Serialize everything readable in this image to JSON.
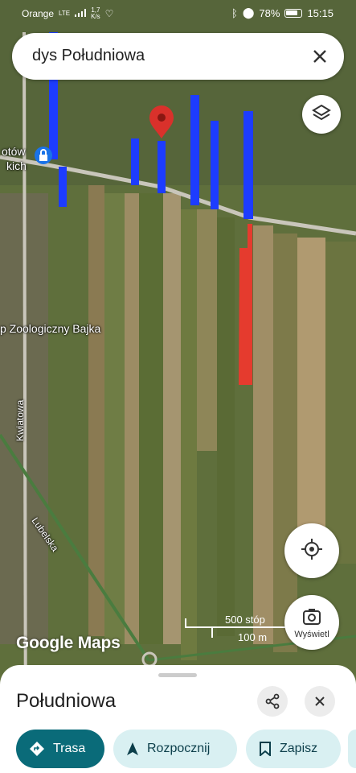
{
  "status_bar": {
    "carrier": "Orange",
    "net_type": "LTE",
    "speed_value": "1,7",
    "speed_unit": "K/s",
    "battery": "78%",
    "time": "15:15"
  },
  "search": {
    "query": "dys Południowa"
  },
  "map": {
    "labels": {
      "ogrod_part1": "otów",
      "ogrod_part2": "kich",
      "zoo": "p Zoologiczny Bajka",
      "street_kwiatowa": "Kwiatowa",
      "street_lubelska": "Lubelska"
    },
    "scale": {
      "feet": "500 stóp",
      "meters": "100 m"
    },
    "watermark": "Google Maps"
  },
  "lens_button": {
    "label": "Wyświetl"
  },
  "place_sheet": {
    "title": "Południowa",
    "actions": [
      {
        "label": "Trasa"
      },
      {
        "label": "Rozpocznij"
      },
      {
        "label": "Zapisz"
      }
    ]
  },
  "colors": {
    "accent": "#0a6b79",
    "parcel_blue": "#1d3cff",
    "parcel_red": "#e53b2e",
    "pin": "#d9312b"
  }
}
